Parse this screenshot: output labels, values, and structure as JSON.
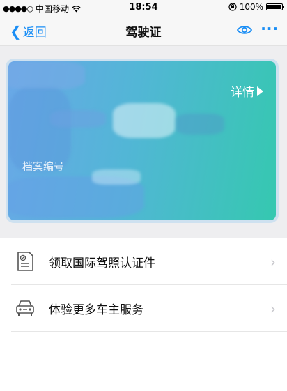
{
  "status_bar": {
    "signal": "●●●●○",
    "carrier": "中国移动",
    "wifi_icon": "wifi-icon",
    "time": "18:54",
    "lock_icon": "rotation-lock-icon",
    "battery_text": "100%",
    "battery_level": 1.0
  },
  "nav": {
    "back_label": "返回",
    "title": "驾驶证",
    "eye_icon": "eye-icon",
    "more_label": "···",
    "accent_color": "#1a8ef5"
  },
  "card": {
    "detail_label": "详情",
    "archive_label": "档案编号",
    "gradient_colors": [
      "#6aa8e8",
      "#35c8b0"
    ]
  },
  "list": {
    "items": [
      {
        "label": "领取国际驾照认证件",
        "icon": "license-document-icon"
      },
      {
        "label": "体验更多车主服务",
        "icon": "car-icon"
      }
    ]
  }
}
